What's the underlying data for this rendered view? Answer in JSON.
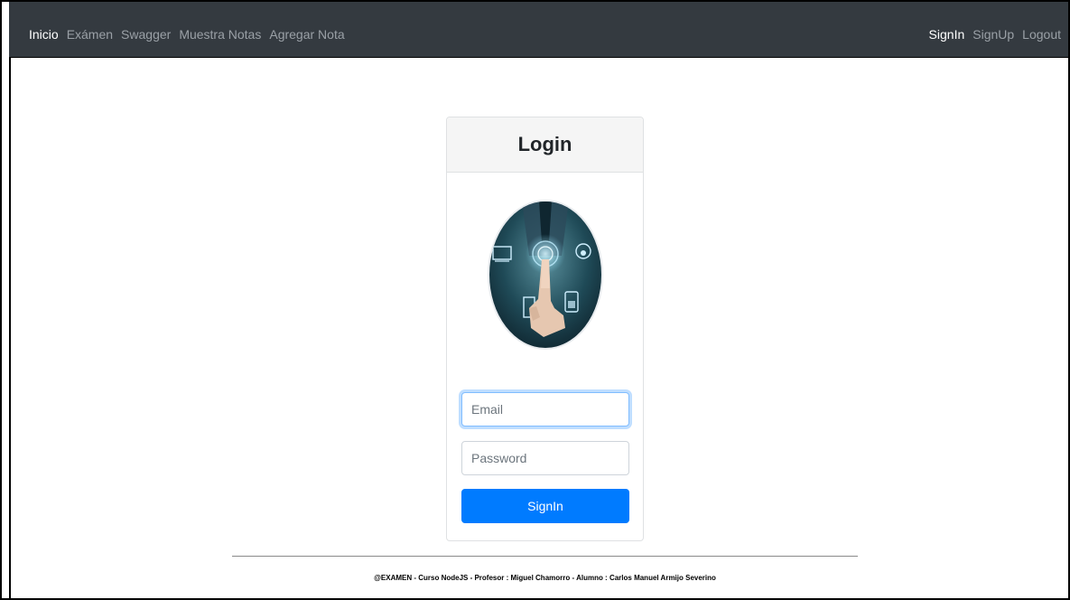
{
  "nav": {
    "brand": "Inicio",
    "left": [
      "Exámen",
      "Swagger",
      "Muestra Notas",
      "Agregar Nota"
    ],
    "right": [
      "SignIn",
      "SignUp",
      "Logout"
    ]
  },
  "login": {
    "title": "Login",
    "email_placeholder": "Email",
    "password_placeholder": "Password",
    "button": "SignIn"
  },
  "footer": "@EXAMEN - Curso NodeJS - Profesor : Miguel Chamorro - Alumno : Carlos Manuel Armijo Severino",
  "colors": {
    "navbar": "#343a40",
    "primary": "#007bff",
    "card_header": "#f5f5f5"
  }
}
